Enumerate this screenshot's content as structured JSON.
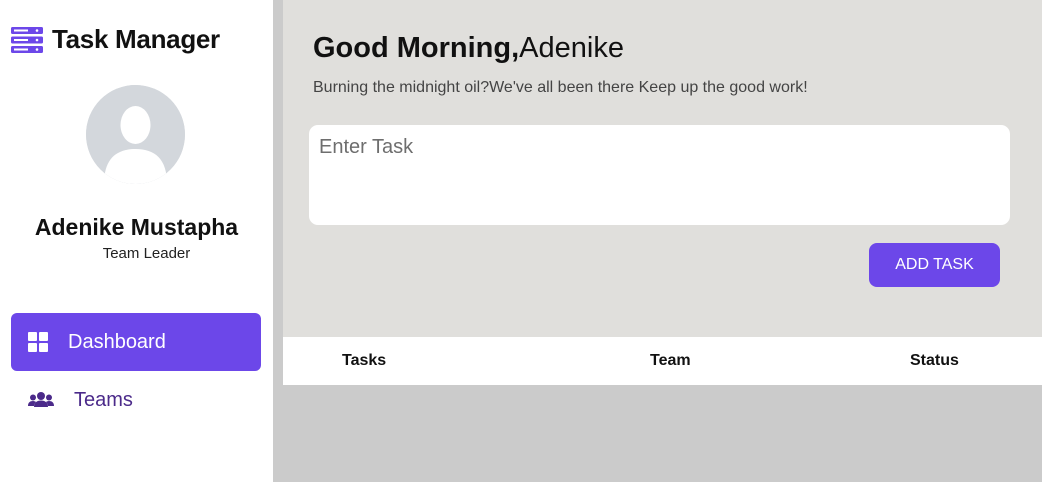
{
  "app": {
    "title": "Task Manager",
    "logo_icon": "server-stack-icon",
    "accent_color": "#6c47e9"
  },
  "user": {
    "name": "Adenike Mustapha",
    "role": "Team Leader",
    "avatar_icon": "default-avatar-icon"
  },
  "nav": {
    "items": [
      {
        "label": "Dashboard",
        "icon": "grid-icon",
        "active": true
      },
      {
        "label": "Teams",
        "icon": "users-icon",
        "active": false
      }
    ]
  },
  "main": {
    "greeting_prefix": "Good Morning,",
    "greeting_name": "Adenike",
    "subtitle": "Burning the midnight oil?We've all been there Keep up the good work!",
    "task_input": {
      "placeholder": "Enter Task",
      "value": ""
    },
    "add_button_label": "ADD TASK"
  },
  "table": {
    "columns": [
      "Tasks",
      "Team",
      "Status"
    ],
    "rows": []
  }
}
